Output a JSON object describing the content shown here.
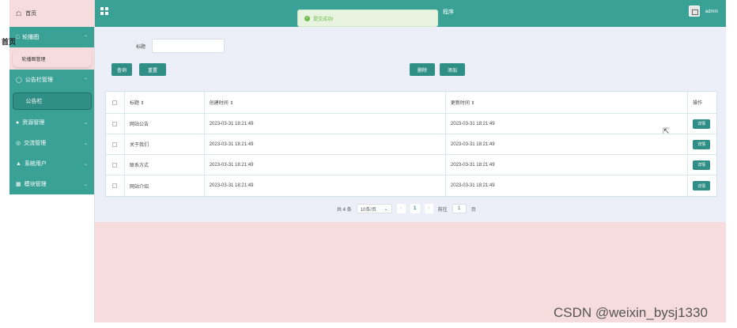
{
  "topbar": {
    "title_tail": "程序",
    "user": "admin"
  },
  "toast": {
    "text": "提交成功!"
  },
  "sidebar": {
    "home": "首页",
    "overlap": "首页",
    "groups": [
      {
        "label": "轮播图",
        "sub": "轮播图管理"
      },
      {
        "label": "公告栏管理",
        "sub": "公告栏"
      },
      {
        "label": "资源管理"
      },
      {
        "label": "交流管理"
      },
      {
        "label": "系统用户"
      },
      {
        "label": "模块管理"
      }
    ]
  },
  "search": {
    "label": "标题",
    "value": ""
  },
  "buttons": {
    "query": "查询",
    "reset": "重置",
    "delete": "删除",
    "add": "添加"
  },
  "table": {
    "headers": [
      "标题 ⇕",
      "创建时间 ⇕",
      "更新时间 ⇕",
      "操作"
    ],
    "rows": [
      {
        "title": "网站公告",
        "created": "2023-03-31 18:21:49",
        "updated": "2023-03-31 18:21:49",
        "action": "详情"
      },
      {
        "title": "关于我们",
        "created": "2023-03-31 18:21:49",
        "updated": "2023-03-31 18:21:49",
        "action": "详情"
      },
      {
        "title": "联系方式",
        "created": "2023-03-31 18:21:49",
        "updated": "2023-03-31 18:21:49",
        "action": "详情"
      },
      {
        "title": "网站介绍",
        "created": "2023-03-31 18:21:49",
        "updated": "2023-03-31 18:21:49",
        "action": "详情"
      }
    ]
  },
  "pager": {
    "total": "共 4 条",
    "page_size": "10条/页",
    "current": "1",
    "goto_label": "前往",
    "goto_value": "1",
    "page_unit": "页"
  },
  "watermark": "CSDN @weixin_bysj1330",
  "colors": {
    "primary": "#3aa196",
    "button": "#2f8e85",
    "pink": "#f6dcdc",
    "panel": "#eceff7"
  }
}
